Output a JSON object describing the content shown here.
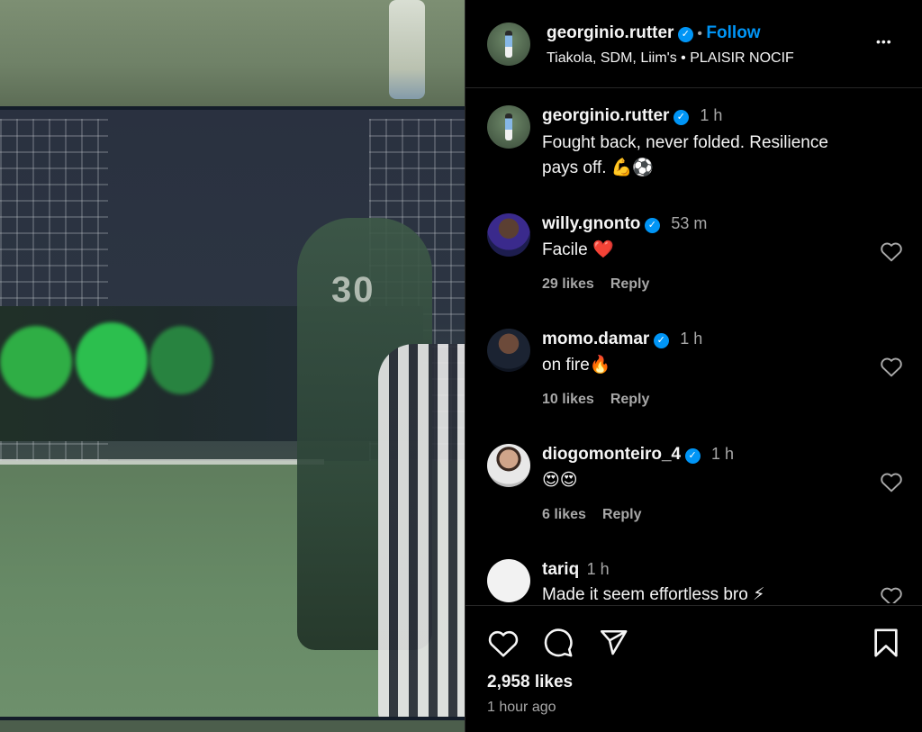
{
  "post": {
    "author": "georginio.rutter",
    "follow_label": "Follow",
    "separator": "•",
    "audio": "Tiakola, SDM, Liim's • PLAISIR NOCIF",
    "more_label": "•••"
  },
  "caption": {
    "author": "georginio.rutter",
    "time": "1 h",
    "text_line1": "Fought back, never folded. Resilience",
    "text_line2": "pays off. 💪⚽"
  },
  "comments": [
    {
      "username": "willy.gnonto",
      "time": "53 m",
      "text": "Facile ❤️",
      "likes": "29 likes",
      "reply": "Reply"
    },
    {
      "username": "momo.damar",
      "time": "1 h",
      "text": "on fire🔥",
      "likes": "10 likes",
      "reply": "Reply"
    },
    {
      "username": "diogomonteiro_4",
      "time": "1 h",
      "text": "😍😍",
      "likes": "6 likes",
      "reply": "Reply"
    },
    {
      "username": "tariq",
      "time": "1 h",
      "text": "Made it seem effortless bro ⚡"
    }
  ],
  "footer": {
    "likes": "2,958 likes",
    "posted": "1 hour ago"
  },
  "colors": {
    "background": "#000000",
    "accent": "#0095f6",
    "secondary_text": "#a8a8a8"
  },
  "icons": [
    "heart-icon",
    "comment-icon",
    "share-icon",
    "bookmark-icon",
    "more-icon",
    "verified-icon"
  ]
}
